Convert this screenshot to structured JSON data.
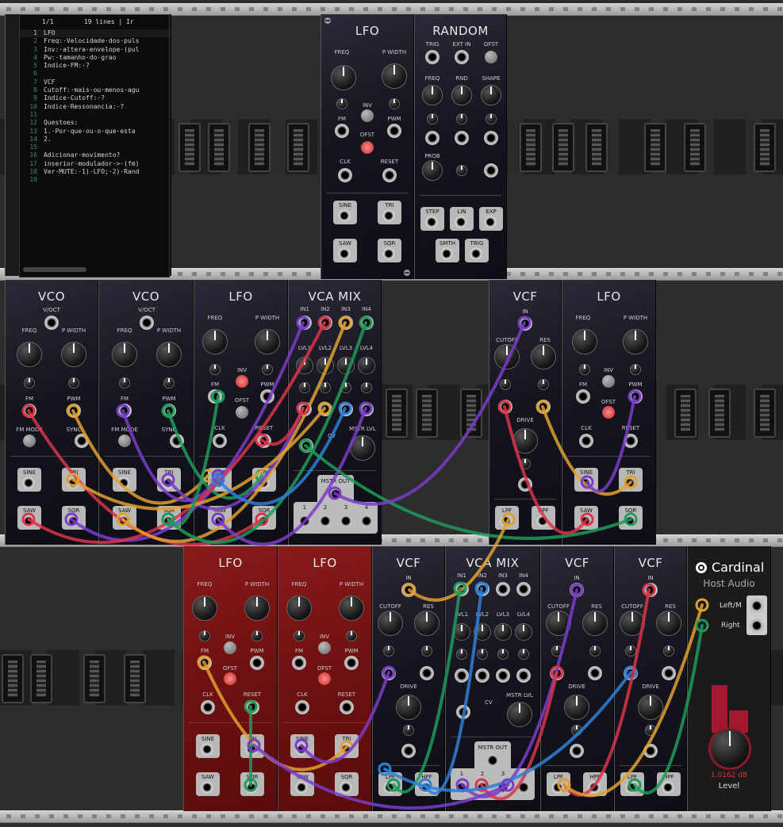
{
  "editor": {
    "header_position": "1/1",
    "header_info": "19 lines | Ir",
    "lines": [
      {
        "n": "1",
        "text": "LFO"
      },
      {
        "n": "2",
        "text": "Freq:·Velocidade·dos·puls"
      },
      {
        "n": "3",
        "text": "Inv:·altera·envelope·(pul"
      },
      {
        "n": "4",
        "text": "Pw:·tamanho·do·grao"
      },
      {
        "n": "5",
        "text": "Indice·FM:·?"
      },
      {
        "n": "6",
        "text": ""
      },
      {
        "n": "7",
        "text": "VCF"
      },
      {
        "n": "8",
        "text": "Cutoff:·mais·ou·menos·agu"
      },
      {
        "n": "9",
        "text": "Indice·Cutoff:·?"
      },
      {
        "n": "10",
        "text": "Indice·Ressonancia:·?"
      },
      {
        "n": "11",
        "text": ""
      },
      {
        "n": "12",
        "text": "Questoes:"
      },
      {
        "n": "13",
        "text": "1.·Por·que·ou·o·que·esta"
      },
      {
        "n": "14",
        "text": "2."
      },
      {
        "n": "15",
        "text": ""
      },
      {
        "n": "16",
        "text": "Adicionar·movimento?"
      },
      {
        "n": "17",
        "text": "inserior·modulador·>·(fm)"
      },
      {
        "n": "18",
        "text": "Ver·MUTE:·1)·LFO;·2)·Rand"
      },
      {
        "n": "19",
        "text": ""
      }
    ]
  },
  "labels": {
    "lfo": "LFO",
    "random": "RANDOM",
    "vco": "VCO",
    "vcamix": "VCA MIX",
    "vcf": "VCF",
    "freq": "FREQ",
    "pwidth": "P WIDTH",
    "inv": "INV",
    "fm": "FM",
    "pwm": "PWM",
    "ofst": "OFST",
    "clk": "CLK",
    "reset": "RESET",
    "sine": "SINE",
    "tri": "TRI",
    "saw": "SAW",
    "sqr": "SQR",
    "voct": "V/OCT",
    "fmmode": "FM MODE",
    "sync": "SYNC",
    "trig": "TRIG",
    "extin": "EXT IN",
    "rnd": "RND",
    "shape": "SHAPE",
    "prob": "PROB",
    "step": "STEP",
    "lin": "LIN",
    "exp": "EXP",
    "smth": "SMTH",
    "in": "IN",
    "cutoff": "CUTOFF",
    "res": "RES",
    "drive": "DRIVE",
    "lpf": "LPF",
    "hpf": "HPF",
    "in1": "IN1",
    "in2": "IN2",
    "in3": "IN3",
    "in4": "IN4",
    "lvl1": "LVL1",
    "lvl2": "LVL2",
    "lvl3": "LVL3",
    "lvl4": "LVL4",
    "cv": "CV",
    "mstrlvl": "MSTR LVL",
    "mstrout": "MSTR OUT",
    "o1": "1",
    "o2": "2",
    "o3": "3",
    "o4": "4"
  },
  "host_audio": {
    "brand": "Cardinal",
    "title": "Host Audio",
    "left": "Left/M",
    "right": "Right",
    "level_value": "1.0162 dB",
    "level_label": "Level"
  },
  "colors": {
    "purple": "#7a3cc8",
    "red": "#d9344a",
    "orange": "#e0a030",
    "green": "#1f9a5a",
    "blue": "#2f7fd8",
    "lfo_red_panel": "#7a1414"
  }
}
